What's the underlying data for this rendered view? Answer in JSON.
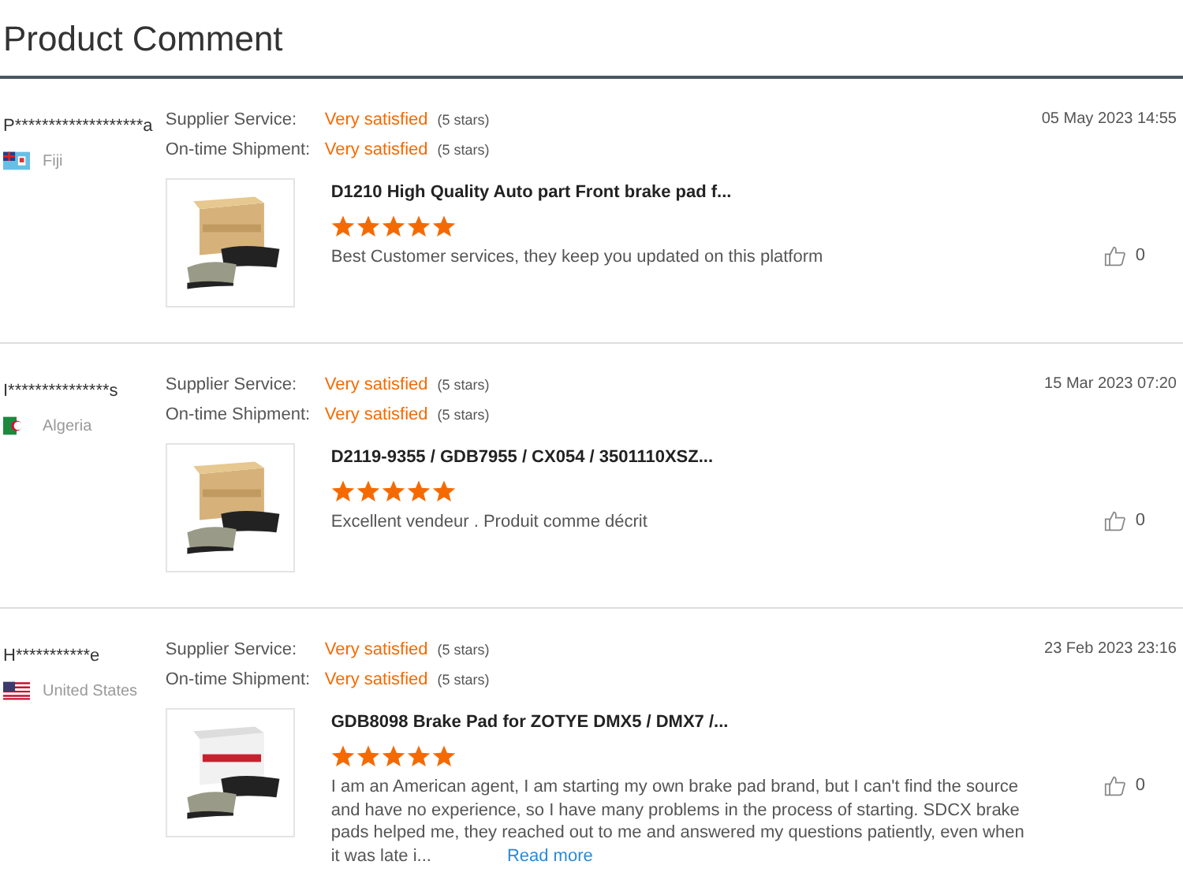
{
  "title": "Product Comment",
  "comments": [
    {
      "user": "P*******************a",
      "country": "Fiji",
      "flag": {
        "kind": "fiji"
      },
      "date": "05 May 2023 14:55",
      "ratings": [
        {
          "label": "Supplier Service:",
          "value": "Very satisfied",
          "note": "(5 stars)"
        },
        {
          "label": "On-time Shipment:",
          "value": "Very satisfied",
          "note": "(5 stars)"
        }
      ],
      "product": "D1210  High Quality Auto part Front brake pad f...",
      "stars": 5,
      "text": "Best Customer services, they keep you updated on this platform",
      "likes": "0"
    },
    {
      "user": "I***************s",
      "country": "Algeria",
      "flag": {
        "kind": "algeria"
      },
      "date": "15 Mar 2023 07:20",
      "ratings": [
        {
          "label": "Supplier Service:",
          "value": "Very satisfied",
          "note": "(5 stars)"
        },
        {
          "label": "On-time Shipment:",
          "value": "Very satisfied",
          "note": "(5 stars)"
        }
      ],
      "product": "D2119-9355 / GDB7955 / CX054 / 3501110XSZ...",
      "stars": 5,
      "text": "Excellent vendeur . Produit comme décrit",
      "likes": "0"
    },
    {
      "user": "H***********e",
      "country": "United States",
      "flag": {
        "kind": "us"
      },
      "date": "23 Feb 2023 23:16",
      "ratings": [
        {
          "label": "Supplier Service:",
          "value": "Very satisfied",
          "note": "(5 stars)"
        },
        {
          "label": "On-time Shipment:",
          "value": "Very satisfied",
          "note": "(5 stars)"
        }
      ],
      "product": "GDB8098 Brake Pad for ZOTYE DMX5 / DMX7 /...",
      "stars": 5,
      "text": "I am an American agent, I am starting my own brake pad brand, but I can't find the source and have no experience, so I have many problems in the process of starting. SDCX brake pads helped me, they reached out to me and answered my questions patiently, even when it was late i...",
      "more": "Read more",
      "likes": "0"
    }
  ]
}
